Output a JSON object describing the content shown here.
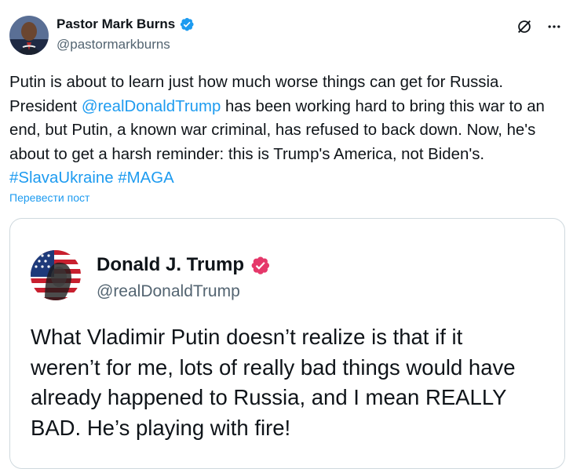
{
  "post": {
    "author": {
      "name": "Pastor Mark Burns",
      "handle": "@pastormarkburns"
    },
    "text": {
      "part1": "Putin is about to learn just how much worse things can get for Russia. President ",
      "mention": "@realDonaldTrump",
      "part2": " has been working hard to bring this war to an end, but Putin, a known war criminal, has refused to back down. Now, he's about to get a harsh reminder: this is Trump's America, not Biden's. ",
      "hashtag1": "#SlavaUkraine",
      "space": " ",
      "hashtag2": "#MAGA"
    },
    "translate_label": "Перевести пост"
  },
  "quoted": {
    "author": {
      "name": "Donald J. Trump",
      "handle": "@realDonaldTrump"
    },
    "text": "What Vladimir Putin doesn’t realize is that if it weren’t for me, lots of really bad things would have already happened to Russia, and I mean REALLY BAD. He’s playing with fire!"
  },
  "icons": {
    "verified_badge": "verified-badge-icon",
    "grok": "grok-icon",
    "more": "more-icon",
    "truth_badge": "truth-verified-icon"
  },
  "colors": {
    "link": "#1d9bf0",
    "verified": "#1d9bf0",
    "truth_badge": "#e5386a",
    "secondary_text": "#536471",
    "border": "#cfd9de"
  }
}
